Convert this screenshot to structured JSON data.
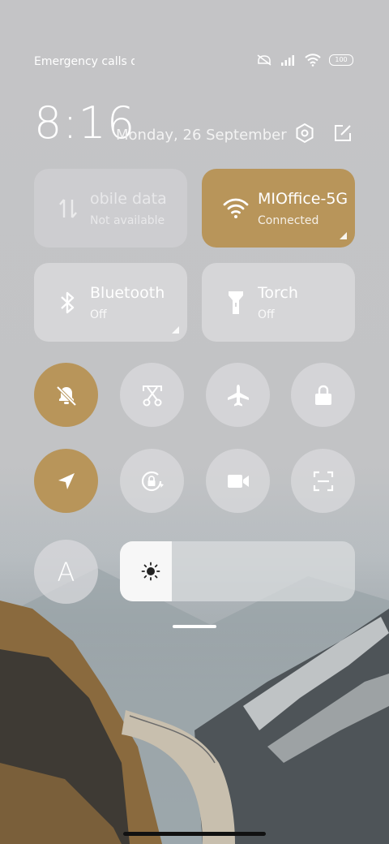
{
  "status_bar": {
    "carrier_text": "Emergency calls o",
    "battery_level": "100"
  },
  "header": {
    "time": "8:16",
    "date": "Monday, 26 September"
  },
  "tiles": [
    {
      "title": "obile data",
      "subtitle": "Not available",
      "icon": "mobile-data-icon",
      "state": "disabled"
    },
    {
      "title": "MIOffice-5G",
      "subtitle": "Connected",
      "icon": "wifi-icon",
      "state": "active"
    },
    {
      "title": "Bluetooth",
      "subtitle": "Off",
      "icon": "bluetooth-icon",
      "state": "off"
    },
    {
      "title": "Torch",
      "subtitle": "Off",
      "icon": "torch-icon",
      "state": "off"
    }
  ],
  "toggles": [
    {
      "icon": "silent-mode-icon",
      "active": true
    },
    {
      "icon": "screenshot-icon",
      "active": false
    },
    {
      "icon": "airplane-icon",
      "active": false
    },
    {
      "icon": "lock-icon",
      "active": false
    },
    {
      "icon": "location-icon",
      "active": true
    },
    {
      "icon": "auto-rotate-icon",
      "active": false
    },
    {
      "icon": "screen-recorder-icon",
      "active": false
    },
    {
      "icon": "scanner-icon",
      "active": false
    }
  ],
  "auto_brightness_label": "A",
  "brightness_level": 0.22,
  "colors": {
    "accent": "#b8955a",
    "tile_bg": "#dcdcde",
    "text": "#ffffff"
  }
}
